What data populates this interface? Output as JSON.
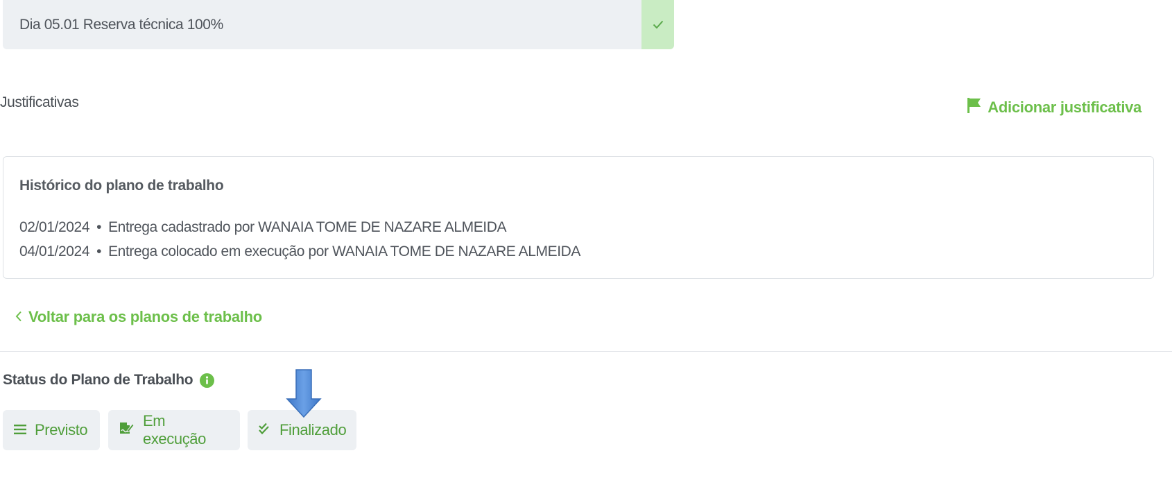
{
  "task": {
    "text": "Dia 05.01 Reserva técnica 100%",
    "check_icon": "check-icon"
  },
  "justificativas": {
    "title": "Justificativas",
    "add_label": "Adicionar justificativa",
    "add_icon": "flag-icon"
  },
  "history": {
    "title": "Histórico do plano de trabalho",
    "separator": "•",
    "entries": [
      {
        "date": "02/01/2024",
        "text": "Entrega cadastrado por WANAIA TOME DE NAZARE ALMEIDA"
      },
      {
        "date": "04/01/2024",
        "text": "Entrega colocado em execução por WANAIA TOME DE NAZARE ALMEIDA"
      }
    ]
  },
  "back": {
    "label": "Voltar para os planos de trabalho",
    "icon": "chevron-left-icon"
  },
  "status": {
    "title": "Status do Plano de Trabalho",
    "info_icon": "info-icon",
    "buttons": [
      {
        "label": "Previsto",
        "icon": "list-icon"
      },
      {
        "label": "Em execução",
        "icon": "edit-signature-icon"
      },
      {
        "label": "Finalizado",
        "icon": "double-check-icon"
      }
    ]
  },
  "annotation": {
    "icon": "down-arrow-icon"
  },
  "colors": {
    "accent_green": "#6cbf4a",
    "button_text_green": "#4f9e3a",
    "check_bg": "#c9ecc3",
    "row_bg": "#edf0f3",
    "arrow_blue": "#4a86d8"
  }
}
